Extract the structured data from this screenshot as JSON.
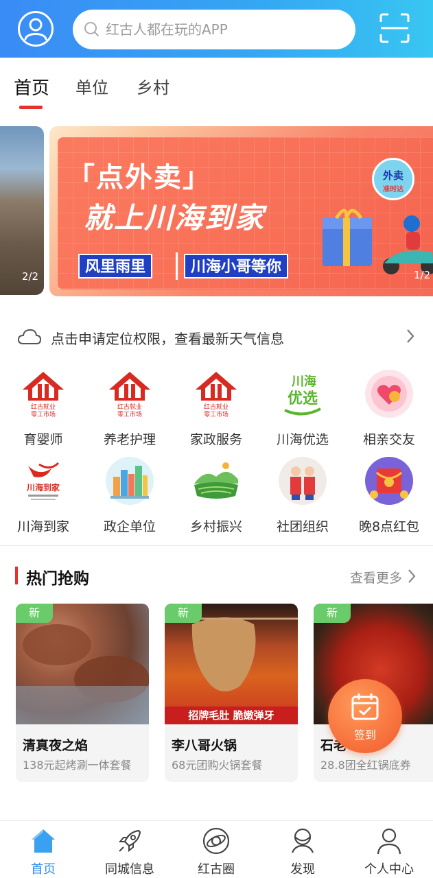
{
  "header": {
    "search_placeholder": "红古人都在玩的APP",
    "icons": [
      "user-icon",
      "search-icon",
      "scan-icon"
    ]
  },
  "tabs": [
    {
      "label": "首页",
      "active": true
    },
    {
      "label": "单位",
      "active": false
    },
    {
      "label": "乡村",
      "active": false
    }
  ],
  "banner": {
    "prev_pager": "2/2",
    "line1": "「点外卖」",
    "line2": "就上川海到家",
    "tag1": "风里雨里",
    "tag2": "川海小哥等你",
    "badge_main": "外卖",
    "badge_sub": "准时达",
    "pager": "1/2"
  },
  "weather": {
    "text": "点击申请定位权限，查看最新天气信息"
  },
  "grid": [
    {
      "label": "育婴师",
      "icon": "hongu-employment-icon"
    },
    {
      "label": "养老护理",
      "icon": "hongu-employment-icon"
    },
    {
      "label": "家政服务",
      "icon": "hongu-employment-icon"
    },
    {
      "label": "川海优选",
      "icon": "chuanhai-youxuan-icon"
    },
    {
      "label": "相亲交友",
      "icon": "heart-icon"
    },
    {
      "label": "川海到家",
      "icon": "chuanhai-daojia-icon"
    },
    {
      "label": "政企单位",
      "icon": "city-buildings-icon"
    },
    {
      "label": "乡村振兴",
      "icon": "farmland-icon"
    },
    {
      "label": "社团组织",
      "icon": "people-icon"
    },
    {
      "label": "晚8点红包",
      "icon": "red-packet-icon"
    }
  ],
  "logo_text": {
    "line1": "红古就业",
    "line2": "零工市场",
    "youxuan_1": "川海",
    "youxuan_2": "优选",
    "daojia": "川海到家"
  },
  "hot": {
    "title": "热门抢购",
    "more": "查看更多",
    "new_badge": "新",
    "items": [
      {
        "title": "清真夜之焰",
        "subtitle": "138元起烤涮一体套餐"
      },
      {
        "title": "李八哥火锅",
        "subtitle": "68元团购火锅套餐",
        "image_text": "招牌毛肚 脆嫩弹牙"
      },
      {
        "title": "石老",
        "subtitle": "28.8团全红锅底券"
      }
    ]
  },
  "signin": {
    "label": "签到"
  },
  "bottom_nav": [
    {
      "label": "首页",
      "icon": "home-icon",
      "active": true
    },
    {
      "label": "同城信息",
      "icon": "rocket-icon",
      "active": false
    },
    {
      "label": "红古圈",
      "icon": "planet-icon",
      "active": false
    },
    {
      "label": "发现",
      "icon": "discover-icon",
      "active": false
    },
    {
      "label": "个人中心",
      "icon": "person-icon",
      "active": false
    }
  ],
  "colors": {
    "header_start": "#3a8bf5",
    "header_end": "#38c6f2",
    "accent_red": "#e5322d",
    "nav_active": "#2f8ff0",
    "new_badge": "#6acb6a"
  }
}
